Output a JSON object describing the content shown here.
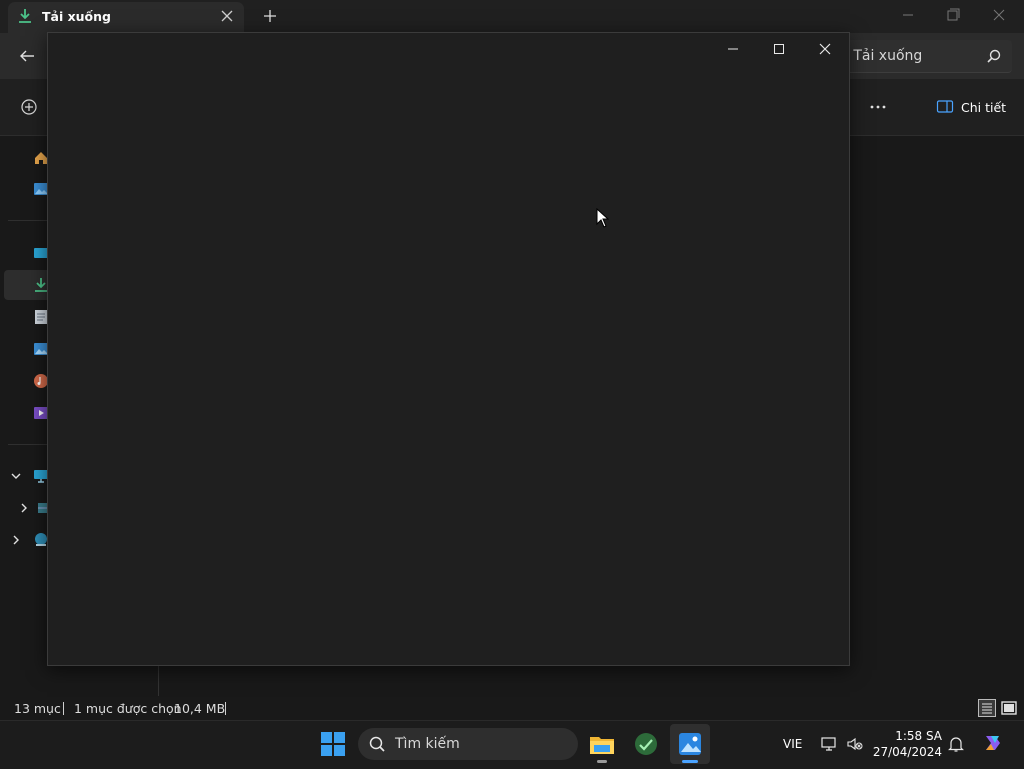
{
  "explorer": {
    "tab": {
      "label": "Tải xuống",
      "icon": "download-icon"
    },
    "search": {
      "text": "g Tải xuống"
    },
    "command_bar": {
      "details_label": "Chi tiết"
    },
    "sidebar": {
      "items": [
        {
          "icon": "home-icon"
        },
        {
          "icon": "gallery-icon"
        },
        {
          "icon": "desktop-icon"
        },
        {
          "icon": "download-icon",
          "selected": true
        },
        {
          "icon": "documents-icon"
        },
        {
          "icon": "pictures-icon"
        },
        {
          "icon": "music-icon"
        },
        {
          "icon": "videos-icon"
        },
        {
          "icon": "this-pc-icon",
          "expanded": true
        },
        {
          "icon": "drive-icon"
        },
        {
          "icon": "network-icon"
        }
      ]
    },
    "status_bar": {
      "item_count": "13 mục",
      "selection": "1 mục được chọn",
      "size": "10,4 MB"
    }
  },
  "taskbar": {
    "search_placeholder": "Tìm kiếm",
    "language": "VIE",
    "time": "1:58 SA",
    "date": "27/04/2024",
    "apps": [
      "file-explorer-icon",
      "app-icon",
      "photos-icon"
    ]
  },
  "colors": {
    "accent_green": "#4cc38a",
    "accent_blue": "#4aa3ff",
    "window_bg": "#1f1f1f"
  }
}
